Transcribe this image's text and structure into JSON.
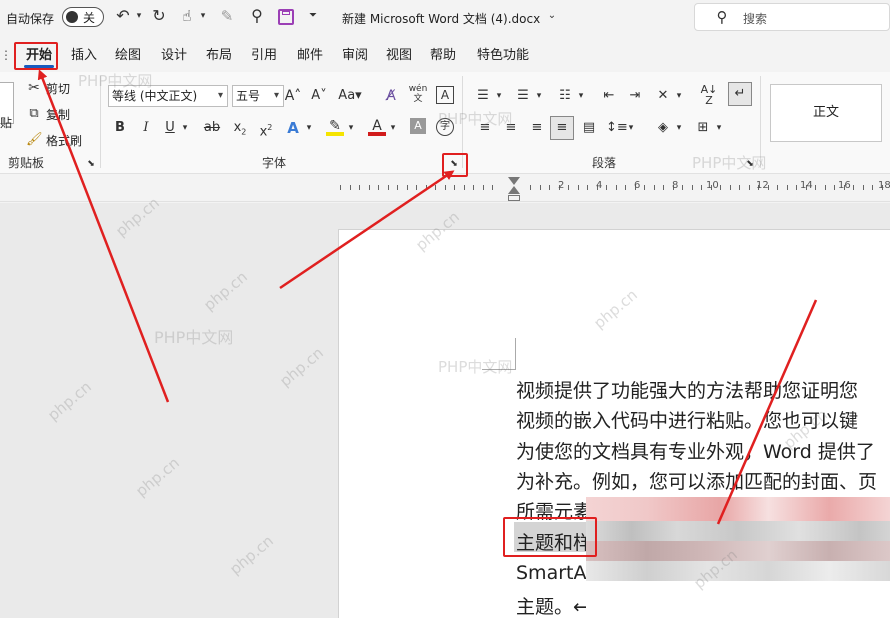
{
  "titlebar": {
    "autosave_label": "自动保存",
    "autosave_state": "关",
    "doc_title": "新建 Microsoft Word 文档 (4).docx",
    "search_placeholder": "搜索"
  },
  "menu": {
    "tabs": [
      "开始",
      "插入",
      "绘图",
      "设计",
      "布局",
      "引用",
      "邮件",
      "审阅",
      "视图",
      "帮助",
      "特色功能"
    ],
    "active": "开始"
  },
  "ribbon": {
    "clipboard": {
      "paste_label": "贴",
      "cut_label": "剪切",
      "copy_label": "复制",
      "format_painter_label": "格式刷",
      "group_label": "剪贴板"
    },
    "font": {
      "font_name": "等线 (中文正文)",
      "font_size": "五号",
      "group_label": "字体"
    },
    "paragraph": {
      "group_label": "段落"
    },
    "styles": {
      "normal_label": "正文"
    }
  },
  "ruler": {
    "numbers": [
      "2",
      "4",
      "6",
      "8",
      "10",
      "12",
      "14",
      "16",
      "18"
    ]
  },
  "document": {
    "lines": [
      "视频提供了功能强大的方法帮助您证明您",
      "视频的嵌入代码中进行粘贴。您也可以键",
      "为使您的文档具有专业外观，Word 提供了",
      "为补充。例如，您可以添加匹配的封面、页",
      "所需元素",
      "主题和样",
      "SmartArt",
      "主题。←"
    ]
  },
  "watermark": {
    "text": "PHP中文网",
    "domain": "php.cn"
  },
  "colors": {
    "annotation": "#e02020",
    "accent": "#185abd",
    "save_icon": "#9b3fb5"
  }
}
